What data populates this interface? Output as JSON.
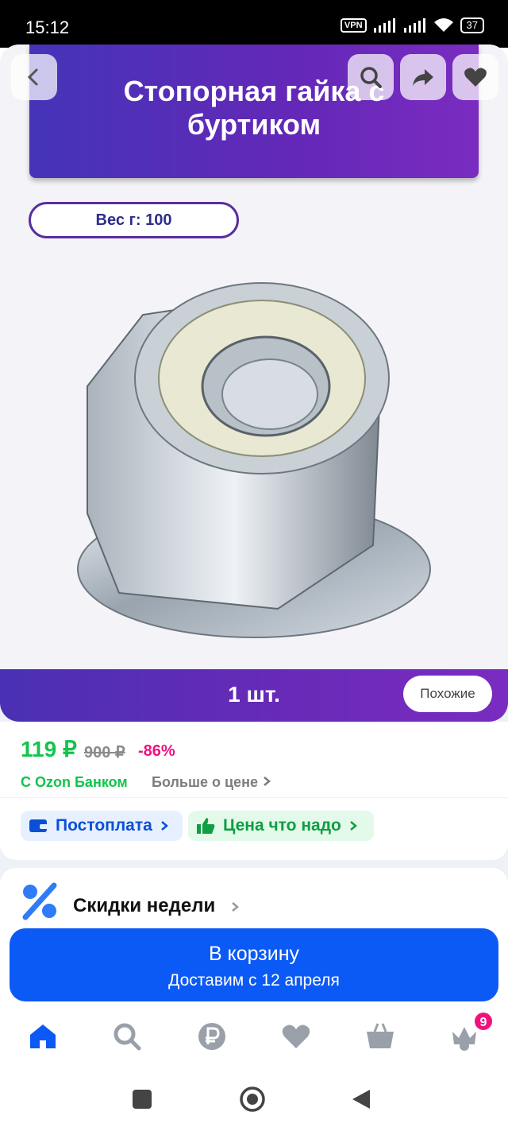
{
  "status_bar": {
    "time": "15:12",
    "vpn": "VPN",
    "battery": "37"
  },
  "product": {
    "title_line1": "Стопорная гайка с",
    "title_line2": "буртиком",
    "weight_label": "Вес г: 100",
    "quantity": "1 шт.",
    "similar_label": "Похожие"
  },
  "toolbar": {
    "icons": [
      "back-icon",
      "search-icon",
      "share-icon",
      "heart-icon"
    ]
  },
  "price": {
    "current": "119 ₽",
    "old": "900 ₽",
    "discount": "-86%",
    "ozon_bank": "С Ozon Банком",
    "more_about_price": "Больше о цене"
  },
  "chips": {
    "postpay": "Постоплата",
    "good_price": "Цена что надо"
  },
  "deals": {
    "title": "Скидки недели"
  },
  "cart": {
    "label": "В корзину",
    "delivery": "Доставим с 12 апреля"
  },
  "tabbar": {
    "icons": [
      "home-icon",
      "search-icon",
      "ruble-icon",
      "heart-icon",
      "cart-icon",
      "profile-icon"
    ],
    "cart_badge": "9"
  },
  "colors": {
    "banner": "#5a2eb8",
    "price_green": "#10c44c",
    "discount_pink": "#f1117e",
    "primary_blue": "#0b5af5"
  }
}
